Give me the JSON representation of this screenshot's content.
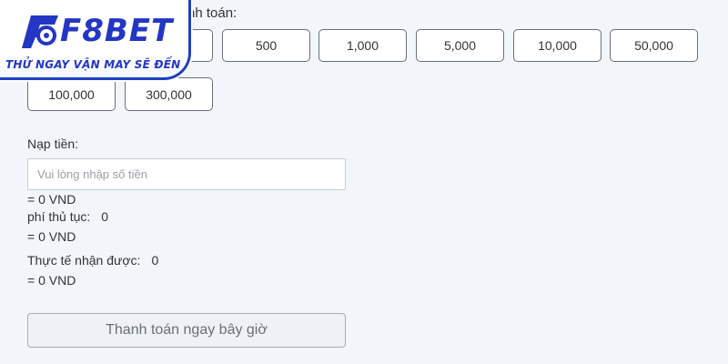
{
  "payment": {
    "section_label": "nh toán:",
    "amounts_row1": [
      "500",
      "1,000",
      "5,000",
      "10,000",
      "50,000"
    ],
    "amounts_row2": [
      "100,000",
      "300,000"
    ]
  },
  "deposit": {
    "label": "Nạp tiền:",
    "placeholder": "Vui lòng nhập số tiền",
    "equals_vnd": "= 0 VND"
  },
  "fee": {
    "label": "phí thủ tục:",
    "value": "0",
    "equals_vnd": "= 0 VND"
  },
  "actual": {
    "label": "Thực tế nhận được:",
    "value": "0",
    "equals_vnd": "= 0 VND"
  },
  "pay_button": {
    "label": "Thanh toán ngay bây giờ"
  },
  "logo": {
    "brand": "F8BET",
    "slogan": "THỬ NGAY VẬN MAY SẼ ĐẾN",
    "color": "#2336c4"
  }
}
